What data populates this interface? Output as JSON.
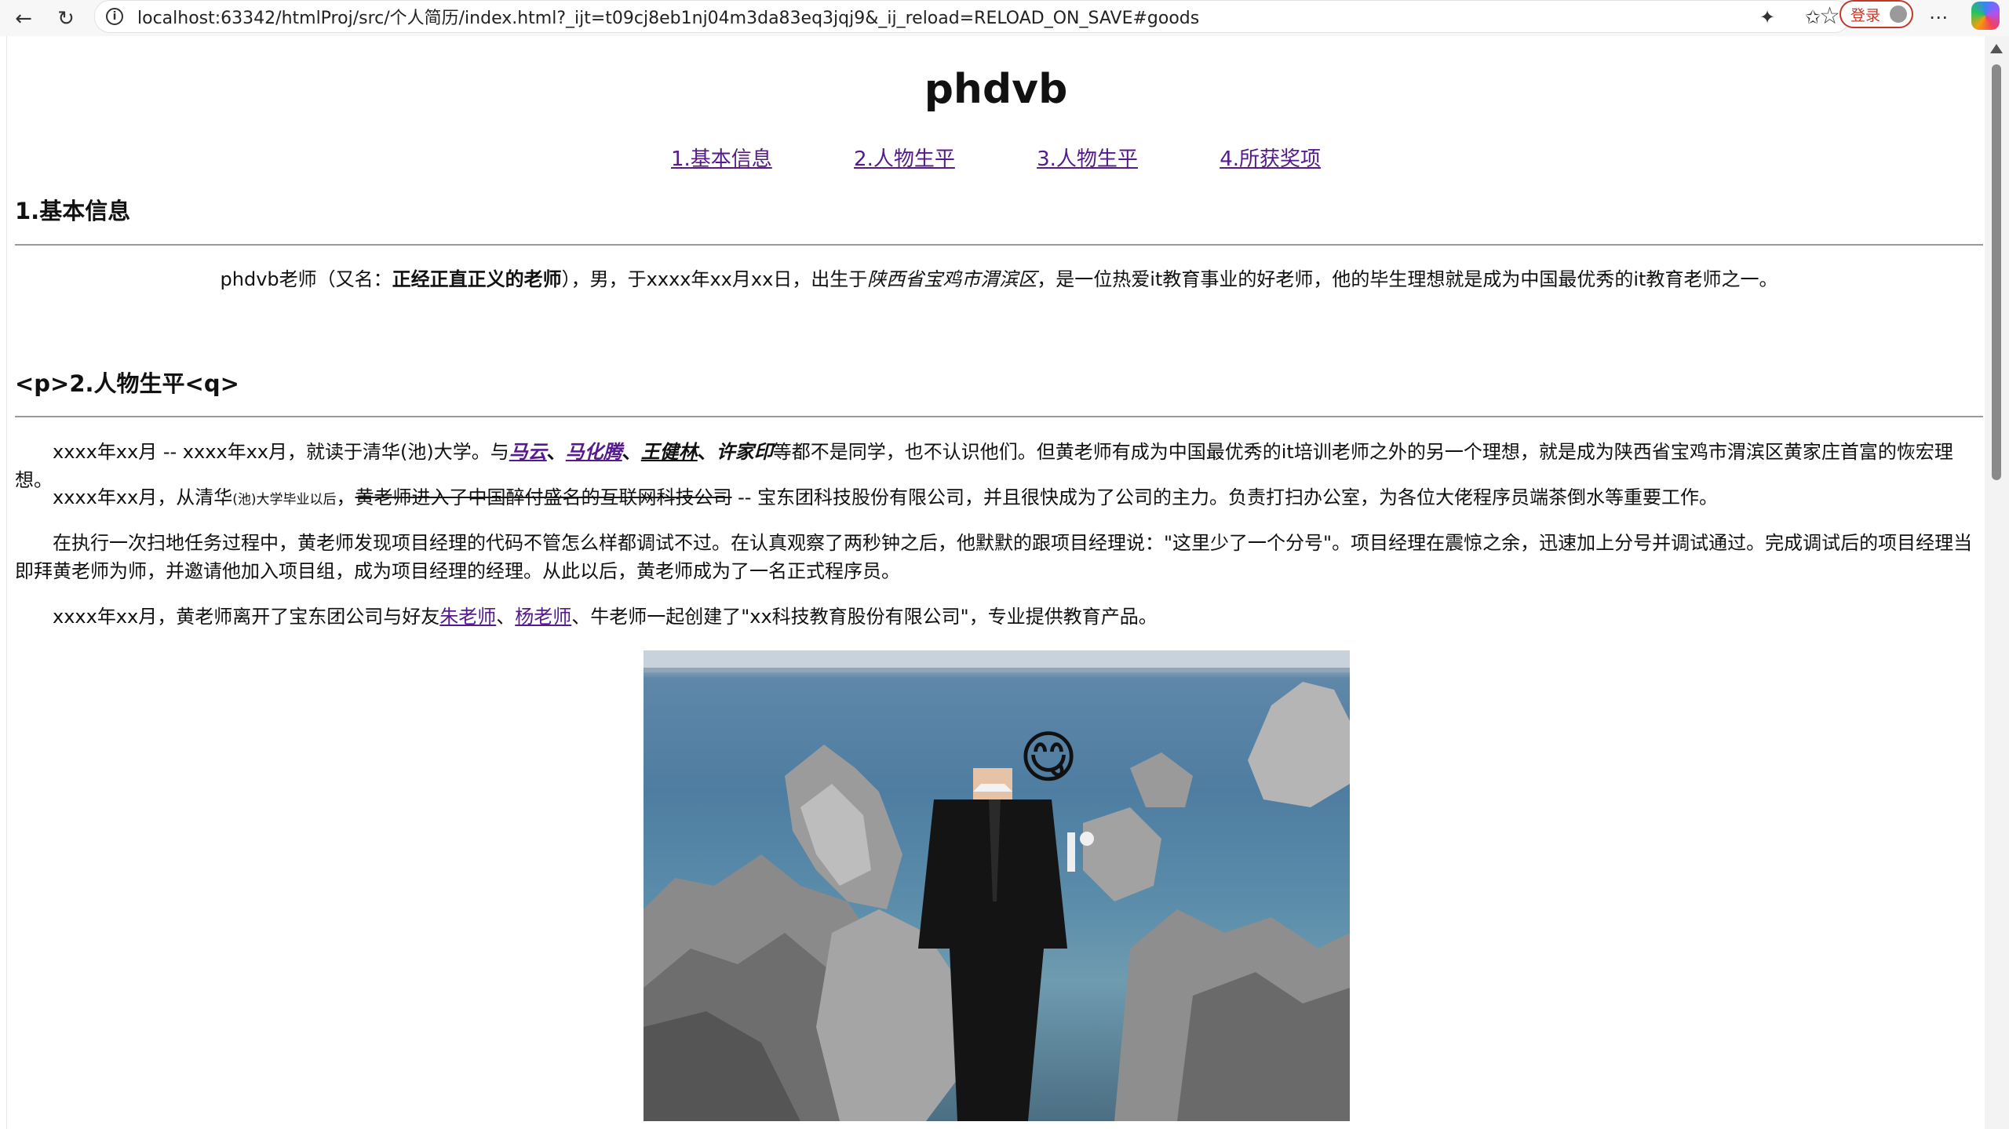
{
  "browser": {
    "url": "localhost:63342/htmlProj/src/个人简历/index.html?_ijt=t09cj8eb1nj04m3da83eq3jqj9&_ij_reload=RELOAD_ON_SAVE#goods",
    "login_label": "登录",
    "icons": [
      "back-arrow-icon",
      "reload-icon",
      "info-icon",
      "star-icon",
      "extensions-icon",
      "favorites-icon",
      "avatar-icon",
      "more-icon",
      "copilot-icon"
    ]
  },
  "page": {
    "title": "phdvb",
    "nav": [
      "1.基本信息",
      "2.人物生平",
      "3.人物生平",
      "4.所获奖项"
    ],
    "section1": {
      "heading": "1.基本信息",
      "p_a": "phdvb老师（又名：",
      "p_bold": "正经正直正义的老师",
      "p_b": "），男，于xxxx年xx月xx日，出生于",
      "p_italic": "陕西省宝鸡市渭滨区",
      "p_c": "，是一位热爱it教育事业的好老师，他的毕生理想就是成为中国最优秀的it教育老师之一。"
    },
    "section2": {
      "heading": "<p>2.人物生平<q>",
      "p1": {
        "a": "xxxx年xx月 -- xxxx年xx月，就读于清华(池)大学。与",
        "n1": "马云",
        "sep1": "、",
        "n2": "马化腾",
        "sep2": "、",
        "n3": "王健林",
        "sep3": "、",
        "n4": "许家印",
        "b": "等都不是同学，也不认识他们。但黄老师有成为中国最优秀的it培训老师之外的另一个理想，就是成为陕西省宝鸡市渭滨区黄家庄首富的恢宏理想。"
      },
      "p2": {
        "a": "xxxx年xx月，从清华",
        "small": "(池)大学毕业以后",
        "sep": "，",
        "strike": "黄老师进入了中国醉付盛名的互联网科技公司",
        "b": " -- 宝东团科技股份有限公司，并且很快成为了公司的主力。负责打扫办公室，为各位大佬程序员端茶倒水等重要工作。"
      },
      "p3": "在执行一次扫地任务过程中，黄老师发现项目经理的代码不管怎么样都调试不过。在认真观察了两秒钟之后，他默默的跟项目经理说：\"这里少了一个分号\"。项目经理在震惊之余，迅速加上分号并调试通过。完成调试后的项目经理当即拜黄老师为师，并邀请他加入项目组，成为项目经理的经理。从此以后，黄老师成为了一名正式程序员。",
      "p4": {
        "a": "xxxx年xx月，黄老师离开了宝东团公司与好友",
        "l1": "朱老师",
        "sep": "、",
        "l2": "杨老师",
        "b": "、牛老师一起创建了\"xx科技教育股份有限公司\"，专业提供教育产品。"
      }
    },
    "photo_emoji": "😋"
  }
}
